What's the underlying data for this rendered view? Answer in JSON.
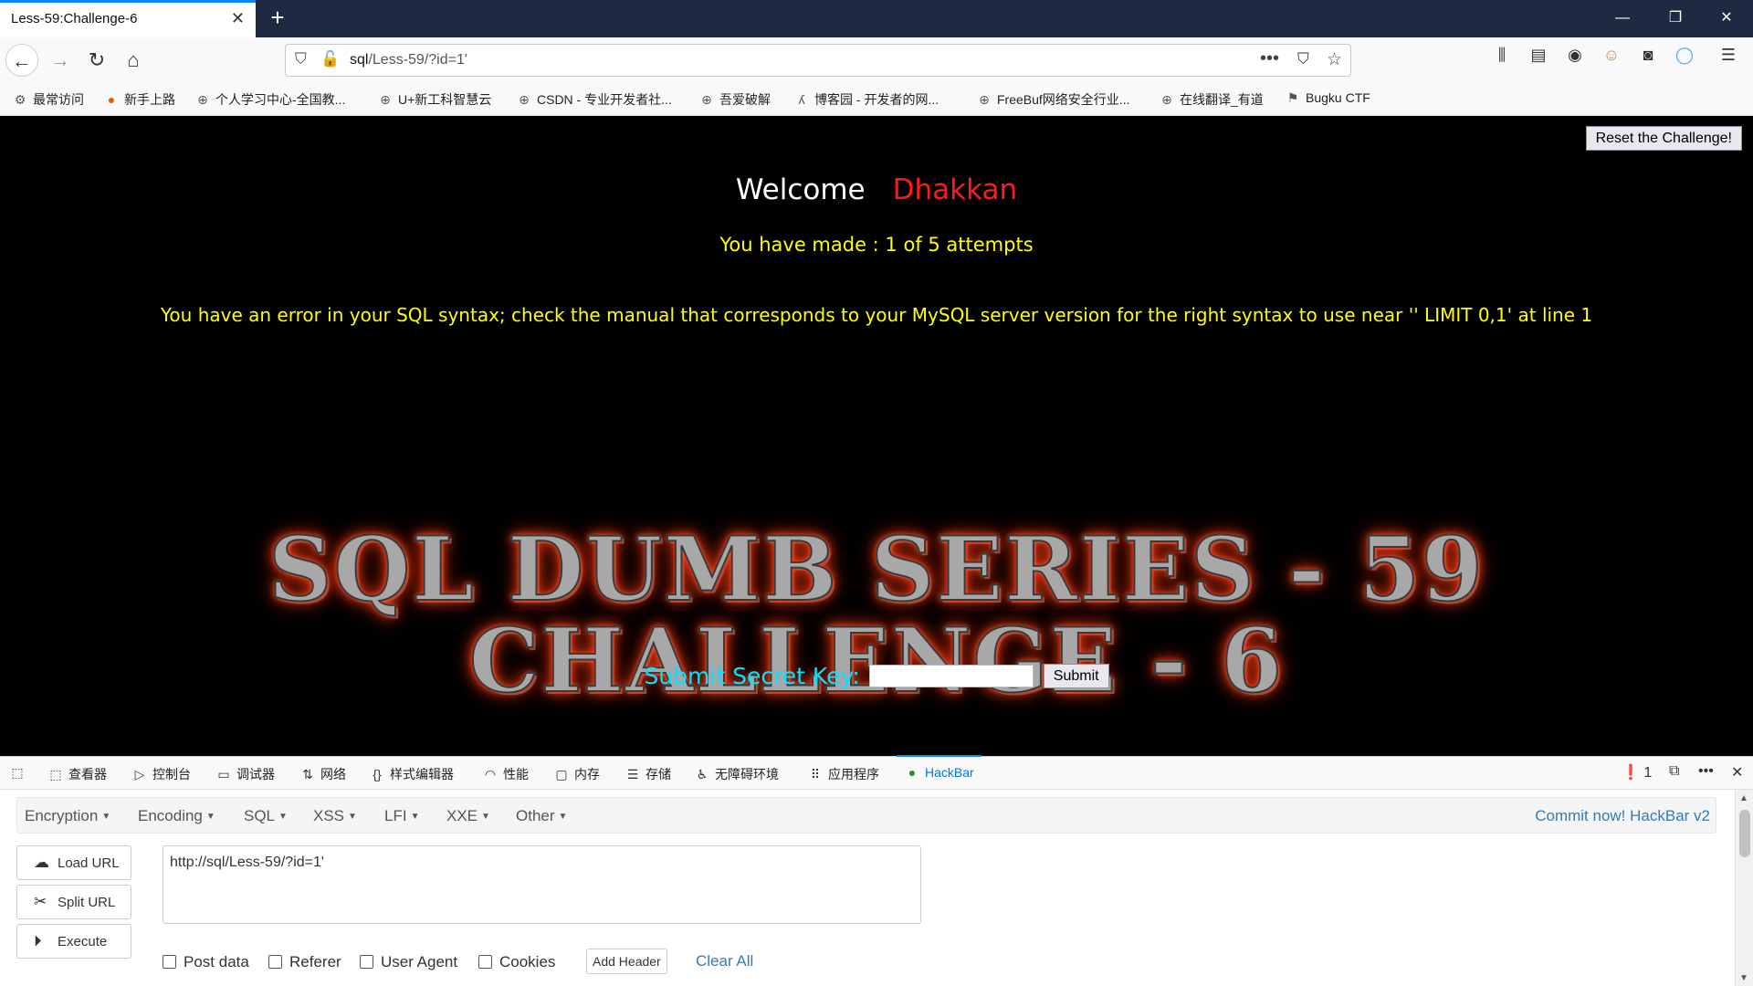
{
  "browser": {
    "tab_title": "Less-59:Challenge-6",
    "tab_close": "✕",
    "new_tab": "+",
    "window": {
      "minimize": "—",
      "restore": "❐",
      "close": "✕"
    },
    "url_host": "sql",
    "url_path": "/Less-59/?id=1'",
    "bookmarks": [
      "最常访问",
      "新手上路",
      "个人学习中心-全国教...",
      "U+新工科智慧云",
      "CSDN - 专业开发者社...",
      "吾爱破解",
      "博客园 - 开发者的网...",
      "FreeBuf网络安全行业...",
      "在线翻译_有道",
      "Bugku CTF"
    ]
  },
  "page": {
    "reset_button": "Reset the Challenge!",
    "welcome": "Welcome",
    "user_name": "Dhakkan",
    "attempts": "You have made : 1 of 5 attempts",
    "sql_error": "You have an error in your SQL syntax; check the manual that corresponds to your MySQL server version for the right syntax to use near '' LIMIT 0,1' at line 1",
    "banner_line1": "SQL DUMB SERIES - 59",
    "banner_line2": "CHALLENGE - 6",
    "secret_label": "Submit Secret Key:",
    "submit_button": "Submit"
  },
  "devtools": {
    "tabs": [
      "查看器",
      "控制台",
      "调试器",
      "网络",
      "样式编辑器",
      "性能",
      "内存",
      "存储",
      "无障碍环境",
      "应用程序",
      "HackBar"
    ],
    "error_count": "1",
    "hackbar": {
      "menus": [
        "Encryption",
        "Encoding",
        "SQL",
        "XSS",
        "LFI",
        "XXE",
        "Other"
      ],
      "commit": "Commit now! HackBar v2",
      "load_url": "Load URL",
      "split_url": "Split URL",
      "execute": "Execute",
      "url_value": "http://sql/Less-59/?id=1'",
      "checkboxes": [
        "Post data",
        "Referer",
        "User Agent",
        "Cookies"
      ],
      "add_header": "Add Header",
      "clear_all": "Clear All"
    }
  }
}
